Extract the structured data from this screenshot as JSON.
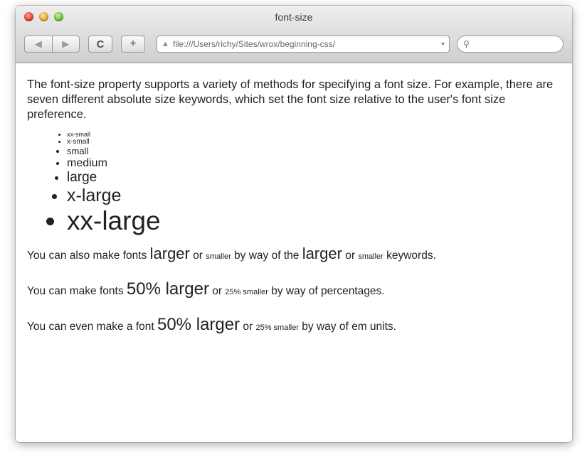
{
  "window": {
    "title": "font-size",
    "buttons": {
      "reload": "C",
      "add": "+"
    },
    "url": "file:///Users/richy/Sites/wrox/beginning-css/",
    "search_placeholder": ""
  },
  "content": {
    "intro": "The font-size property supports a variety of methods for specifying a font size. For example, there are seven different absolute size keywords, which set the font size relative to the user's font size preference.",
    "size_items": [
      {
        "label": "xx-small",
        "size": "xx-small"
      },
      {
        "label": "x-small",
        "size": "x-small"
      },
      {
        "label": "small",
        "size": "small"
      },
      {
        "label": "medium",
        "size": "medium"
      },
      {
        "label": "large",
        "size": "large"
      },
      {
        "label": "x-large",
        "size": "x-large"
      },
      {
        "label": "xx-large",
        "size": "xx-large"
      }
    ],
    "p1": {
      "before": "You can also make fonts ",
      "larger": "larger",
      "or": " or ",
      "smaller": "smaller",
      "middle": " by way of the ",
      "larger_kw": "larger",
      "or2": " or ",
      "smaller_kw": "smaller",
      "after": " keywords."
    },
    "p2": {
      "before": "You can make fonts ",
      "big": "50% larger",
      "or": " or ",
      "small": "25% smaller",
      "after": " by way of percentages."
    },
    "p3": {
      "before": "You can even make a font ",
      "big": "50% larger",
      "or": " or ",
      "small": "25% smaller",
      "after": " by way of em units."
    }
  }
}
